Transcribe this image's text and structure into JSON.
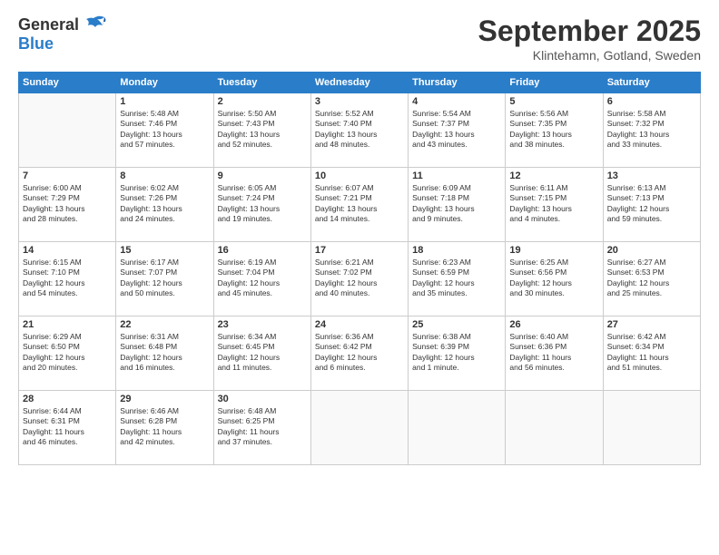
{
  "header": {
    "logo_general": "General",
    "logo_blue": "Blue",
    "month_title": "September 2025",
    "location": "Klintehamn, Gotland, Sweden"
  },
  "days_of_week": [
    "Sunday",
    "Monday",
    "Tuesday",
    "Wednesday",
    "Thursday",
    "Friday",
    "Saturday"
  ],
  "weeks": [
    [
      {
        "day": "",
        "info": ""
      },
      {
        "day": "1",
        "info": "Sunrise: 5:48 AM\nSunset: 7:46 PM\nDaylight: 13 hours\nand 57 minutes."
      },
      {
        "day": "2",
        "info": "Sunrise: 5:50 AM\nSunset: 7:43 PM\nDaylight: 13 hours\nand 52 minutes."
      },
      {
        "day": "3",
        "info": "Sunrise: 5:52 AM\nSunset: 7:40 PM\nDaylight: 13 hours\nand 48 minutes."
      },
      {
        "day": "4",
        "info": "Sunrise: 5:54 AM\nSunset: 7:37 PM\nDaylight: 13 hours\nand 43 minutes."
      },
      {
        "day": "5",
        "info": "Sunrise: 5:56 AM\nSunset: 7:35 PM\nDaylight: 13 hours\nand 38 minutes."
      },
      {
        "day": "6",
        "info": "Sunrise: 5:58 AM\nSunset: 7:32 PM\nDaylight: 13 hours\nand 33 minutes."
      }
    ],
    [
      {
        "day": "7",
        "info": "Sunrise: 6:00 AM\nSunset: 7:29 PM\nDaylight: 13 hours\nand 28 minutes."
      },
      {
        "day": "8",
        "info": "Sunrise: 6:02 AM\nSunset: 7:26 PM\nDaylight: 13 hours\nand 24 minutes."
      },
      {
        "day": "9",
        "info": "Sunrise: 6:05 AM\nSunset: 7:24 PM\nDaylight: 13 hours\nand 19 minutes."
      },
      {
        "day": "10",
        "info": "Sunrise: 6:07 AM\nSunset: 7:21 PM\nDaylight: 13 hours\nand 14 minutes."
      },
      {
        "day": "11",
        "info": "Sunrise: 6:09 AM\nSunset: 7:18 PM\nDaylight: 13 hours\nand 9 minutes."
      },
      {
        "day": "12",
        "info": "Sunrise: 6:11 AM\nSunset: 7:15 PM\nDaylight: 13 hours\nand 4 minutes."
      },
      {
        "day": "13",
        "info": "Sunrise: 6:13 AM\nSunset: 7:13 PM\nDaylight: 12 hours\nand 59 minutes."
      }
    ],
    [
      {
        "day": "14",
        "info": "Sunrise: 6:15 AM\nSunset: 7:10 PM\nDaylight: 12 hours\nand 54 minutes."
      },
      {
        "day": "15",
        "info": "Sunrise: 6:17 AM\nSunset: 7:07 PM\nDaylight: 12 hours\nand 50 minutes."
      },
      {
        "day": "16",
        "info": "Sunrise: 6:19 AM\nSunset: 7:04 PM\nDaylight: 12 hours\nand 45 minutes."
      },
      {
        "day": "17",
        "info": "Sunrise: 6:21 AM\nSunset: 7:02 PM\nDaylight: 12 hours\nand 40 minutes."
      },
      {
        "day": "18",
        "info": "Sunrise: 6:23 AM\nSunset: 6:59 PM\nDaylight: 12 hours\nand 35 minutes."
      },
      {
        "day": "19",
        "info": "Sunrise: 6:25 AM\nSunset: 6:56 PM\nDaylight: 12 hours\nand 30 minutes."
      },
      {
        "day": "20",
        "info": "Sunrise: 6:27 AM\nSunset: 6:53 PM\nDaylight: 12 hours\nand 25 minutes."
      }
    ],
    [
      {
        "day": "21",
        "info": "Sunrise: 6:29 AM\nSunset: 6:50 PM\nDaylight: 12 hours\nand 20 minutes."
      },
      {
        "day": "22",
        "info": "Sunrise: 6:31 AM\nSunset: 6:48 PM\nDaylight: 12 hours\nand 16 minutes."
      },
      {
        "day": "23",
        "info": "Sunrise: 6:34 AM\nSunset: 6:45 PM\nDaylight: 12 hours\nand 11 minutes."
      },
      {
        "day": "24",
        "info": "Sunrise: 6:36 AM\nSunset: 6:42 PM\nDaylight: 12 hours\nand 6 minutes."
      },
      {
        "day": "25",
        "info": "Sunrise: 6:38 AM\nSunset: 6:39 PM\nDaylight: 12 hours\nand 1 minute."
      },
      {
        "day": "26",
        "info": "Sunrise: 6:40 AM\nSunset: 6:36 PM\nDaylight: 11 hours\nand 56 minutes."
      },
      {
        "day": "27",
        "info": "Sunrise: 6:42 AM\nSunset: 6:34 PM\nDaylight: 11 hours\nand 51 minutes."
      }
    ],
    [
      {
        "day": "28",
        "info": "Sunrise: 6:44 AM\nSunset: 6:31 PM\nDaylight: 11 hours\nand 46 minutes."
      },
      {
        "day": "29",
        "info": "Sunrise: 6:46 AM\nSunset: 6:28 PM\nDaylight: 11 hours\nand 42 minutes."
      },
      {
        "day": "30",
        "info": "Sunrise: 6:48 AM\nSunset: 6:25 PM\nDaylight: 11 hours\nand 37 minutes."
      },
      {
        "day": "",
        "info": ""
      },
      {
        "day": "",
        "info": ""
      },
      {
        "day": "",
        "info": ""
      },
      {
        "day": "",
        "info": ""
      }
    ]
  ]
}
